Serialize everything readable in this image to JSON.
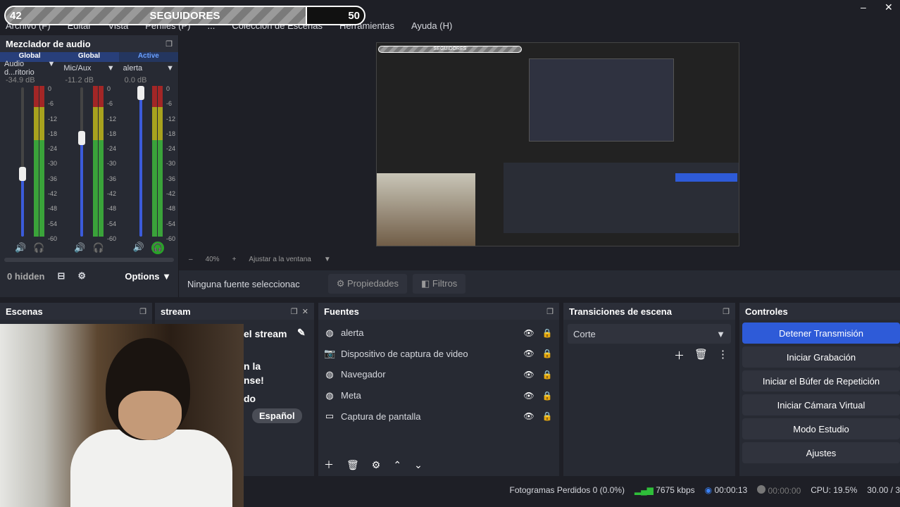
{
  "overlay": {
    "left": "42",
    "label": "SEGUIDORES",
    "right": "50",
    "progress": 0.84
  },
  "menu": {
    "items": [
      "Archivo (F)",
      "Editar",
      "Vista",
      "Perfiles (P)",
      "...",
      "Colección de Escenas",
      "Herramientas",
      "Ayuda (H)"
    ]
  },
  "window": {
    "minimize": "–",
    "close": "✕"
  },
  "mixer": {
    "title": "Mezclador de audio",
    "tags": [
      "Global",
      "Global",
      "Active"
    ],
    "channels": [
      {
        "name": "Audio d...ritorio",
        "db": "-34.9 dB",
        "volume": 0.42
      },
      {
        "name": "Mic/Aux",
        "db": "-11.2 dB",
        "volume": 0.66
      },
      {
        "name": "alerta",
        "db": "0.0 dB",
        "volume": 1.0
      }
    ],
    "ticks": [
      "0",
      "-6",
      "-12",
      "-18",
      "-24",
      "-30",
      "-36",
      "-42",
      "-48",
      "-54",
      "-60"
    ],
    "hidden": "0 hidden",
    "options": "Options"
  },
  "preview": {
    "mini_label": "SEGUIDORES",
    "zoom": "40%",
    "fit": "Ajustar a la ventana"
  },
  "source_toolbar": {
    "none_selected": "Ninguna fuente seleccionac",
    "properties": "Propiedades",
    "filters": "Filtros"
  },
  "docks": {
    "scenes": "Escenas",
    "stream": "stream",
    "sources": "Fuentes",
    "transitions": "Transiciones de escena",
    "controls": "Controles"
  },
  "stream_text": {
    "title": "el stream",
    "l1": "n la",
    "l2": "nse!",
    "l3": "do",
    "lang": "Español"
  },
  "sources": [
    {
      "icon": "globe-icon",
      "label": "alerta"
    },
    {
      "icon": "camera-icon",
      "label": "Dispositivo de captura de video"
    },
    {
      "icon": "globe-icon",
      "label": "Navegador"
    },
    {
      "icon": "globe-icon",
      "label": "Meta"
    },
    {
      "icon": "monitor-icon",
      "label": "Captura de pantalla"
    }
  ],
  "transition": {
    "selected": "Corte"
  },
  "controls": [
    "Detener Transmisión",
    "Iniciar Grabación",
    "Iniciar el Búfer de Repetición",
    "Iniciar Cámara Virtual",
    "Modo Estudio",
    "Ajustes"
  ],
  "status": {
    "dropped": "Fotogramas Perdidos 0 (0.0%)",
    "kbps": "7675 kbps",
    "stream_time": "00:00:13",
    "rec_time": "00:00:00",
    "cpu": "CPU: 19.5%",
    "fps": "30.00 / 3"
  },
  "colors": {
    "accent": "#2e5bd8",
    "panel": "#272a33",
    "background": "#1e1f26"
  }
}
